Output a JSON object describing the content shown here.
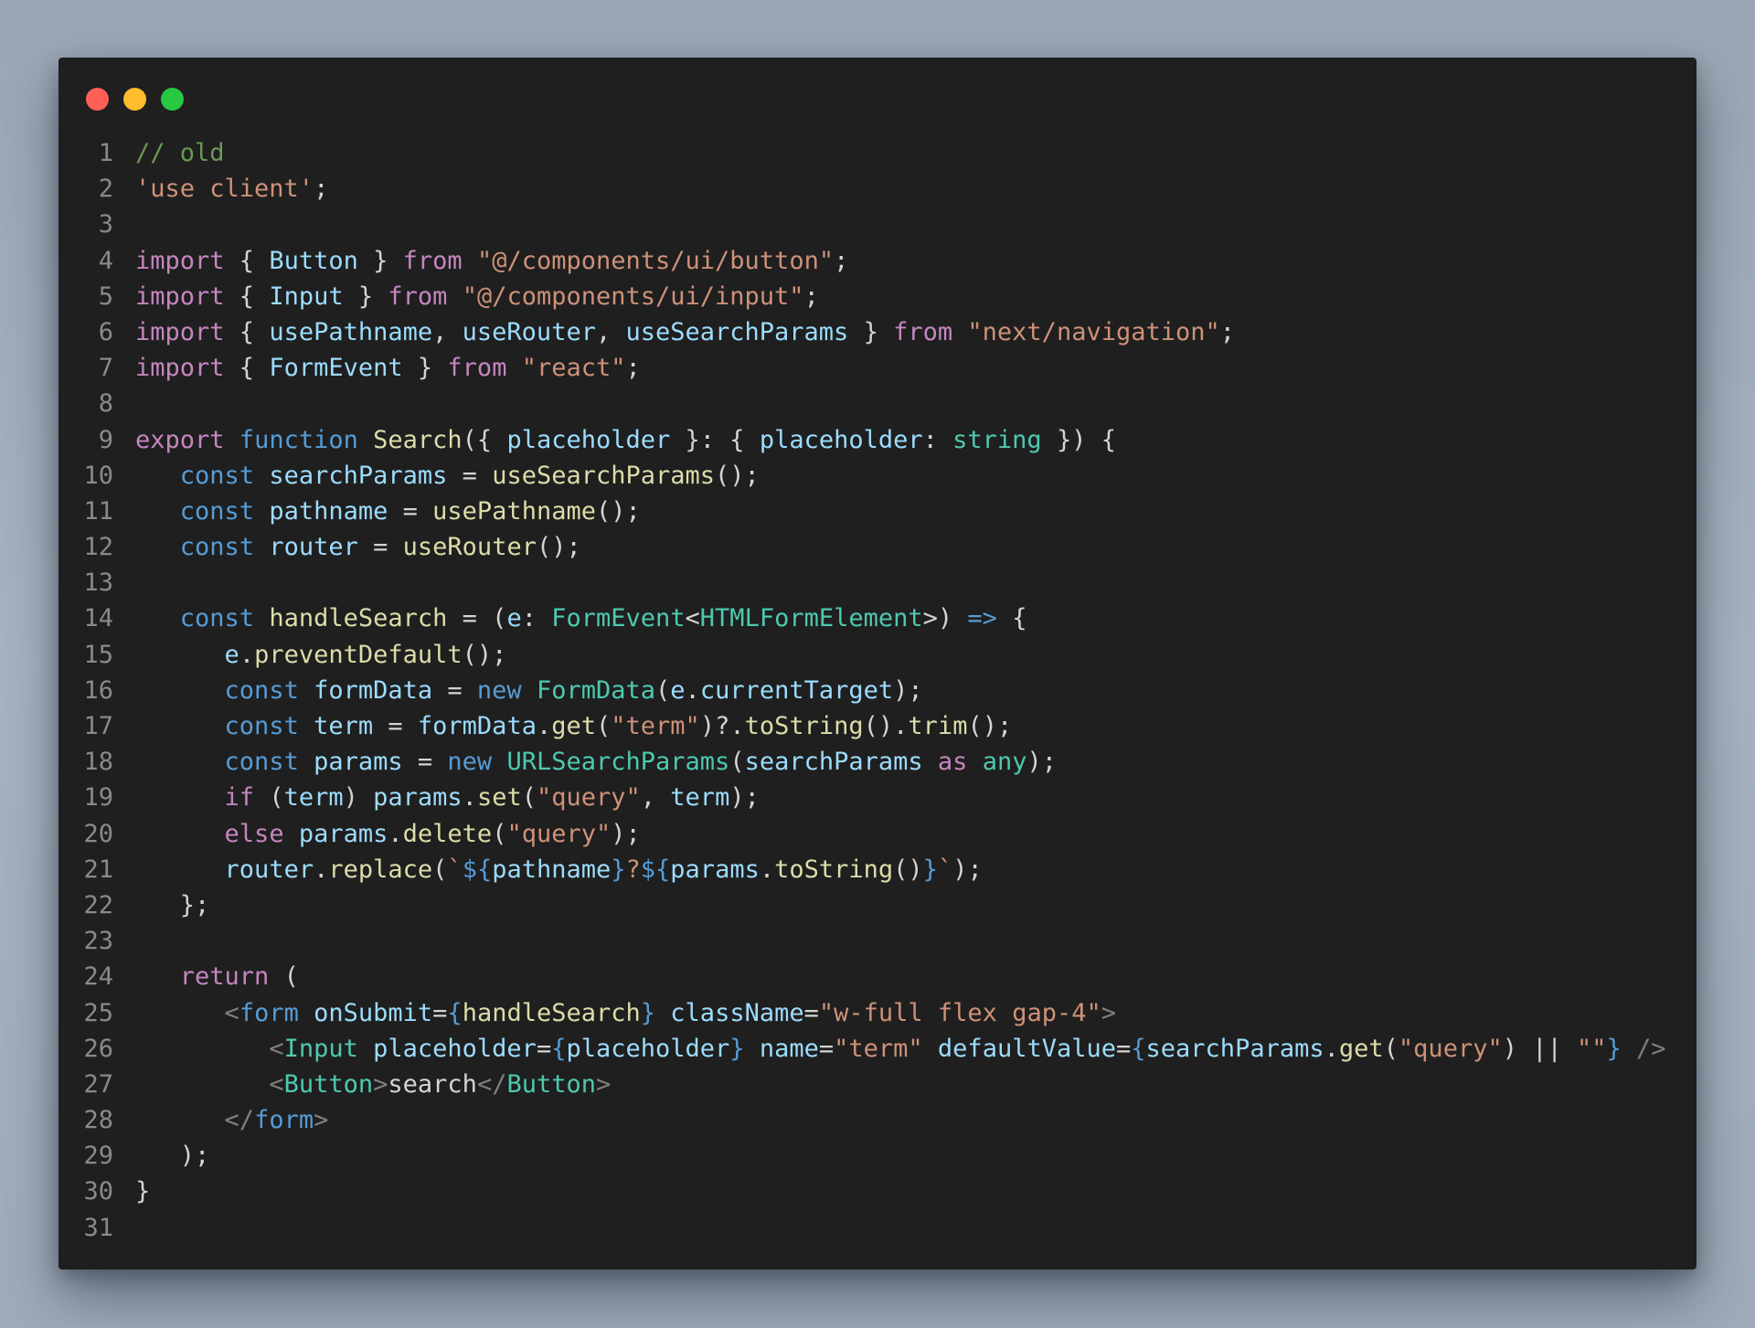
{
  "window": {
    "traffic_lights": {
      "close_color": "#ff5f57",
      "minimize_color": "#febc2e",
      "zoom_color": "#28c840"
    }
  },
  "colors": {
    "background": "#a4b0bd",
    "editor_background": "#1f1f1f",
    "line_number": "#8a8a8a",
    "comment": "#6a9955",
    "keyword": "#c586c0",
    "declaration": "#569cd6",
    "string": "#ce9178",
    "variable": "#9cdcfe",
    "function": "#dcdcaa",
    "type": "#4ec9b0",
    "plain": "#d4d4d4",
    "tag_bracket": "#808080"
  },
  "code": {
    "lines": [
      {
        "n": "1",
        "tokens": [
          [
            "comment",
            "// old"
          ]
        ]
      },
      {
        "n": "2",
        "tokens": [
          [
            "str",
            "'use client'"
          ],
          [
            "punct",
            ";"
          ]
        ]
      },
      {
        "n": "3",
        "tokens": []
      },
      {
        "n": "4",
        "tokens": [
          [
            "kw",
            "import"
          ],
          [
            "punct",
            " { "
          ],
          [
            "var",
            "Button"
          ],
          [
            "punct",
            " } "
          ],
          [
            "kw",
            "from"
          ],
          [
            "punct",
            " "
          ],
          [
            "str",
            "\"@/components/ui/button\""
          ],
          [
            "punct",
            ";"
          ]
        ]
      },
      {
        "n": "5",
        "tokens": [
          [
            "kw",
            "import"
          ],
          [
            "punct",
            " { "
          ],
          [
            "var",
            "Input"
          ],
          [
            "punct",
            " } "
          ],
          [
            "kw",
            "from"
          ],
          [
            "punct",
            " "
          ],
          [
            "str",
            "\"@/components/ui/input\""
          ],
          [
            "punct",
            ";"
          ]
        ]
      },
      {
        "n": "6",
        "tokens": [
          [
            "kw",
            "import"
          ],
          [
            "punct",
            " { "
          ],
          [
            "var",
            "usePathname"
          ],
          [
            "punct",
            ", "
          ],
          [
            "var",
            "useRouter"
          ],
          [
            "punct",
            ", "
          ],
          [
            "var",
            "useSearchParams"
          ],
          [
            "punct",
            " } "
          ],
          [
            "kw",
            "from"
          ],
          [
            "punct",
            " "
          ],
          [
            "str",
            "\"next/navigation\""
          ],
          [
            "punct",
            ";"
          ]
        ]
      },
      {
        "n": "7",
        "tokens": [
          [
            "kw",
            "import"
          ],
          [
            "punct",
            " { "
          ],
          [
            "var",
            "FormEvent"
          ],
          [
            "punct",
            " } "
          ],
          [
            "kw",
            "from"
          ],
          [
            "punct",
            " "
          ],
          [
            "str",
            "\"react\""
          ],
          [
            "punct",
            ";"
          ]
        ]
      },
      {
        "n": "8",
        "tokens": []
      },
      {
        "n": "9",
        "tokens": [
          [
            "kw",
            "export"
          ],
          [
            "punct",
            " "
          ],
          [
            "decl",
            "function"
          ],
          [
            "punct",
            " "
          ],
          [
            "fn",
            "Search"
          ],
          [
            "punct",
            "({ "
          ],
          [
            "var",
            "placeholder"
          ],
          [
            "punct",
            " }: { "
          ],
          [
            "var",
            "placeholder"
          ],
          [
            "punct",
            ": "
          ],
          [
            "type",
            "string"
          ],
          [
            "punct",
            " }) {"
          ]
        ]
      },
      {
        "n": "10",
        "tokens": [
          [
            "punct",
            "   "
          ],
          [
            "decl",
            "const"
          ],
          [
            "punct",
            " "
          ],
          [
            "var",
            "searchParams"
          ],
          [
            "punct",
            " = "
          ],
          [
            "fn",
            "useSearchParams"
          ],
          [
            "punct",
            "();"
          ]
        ]
      },
      {
        "n": "11",
        "tokens": [
          [
            "punct",
            "   "
          ],
          [
            "decl",
            "const"
          ],
          [
            "punct",
            " "
          ],
          [
            "var",
            "pathname"
          ],
          [
            "punct",
            " = "
          ],
          [
            "fn",
            "usePathname"
          ],
          [
            "punct",
            "();"
          ]
        ]
      },
      {
        "n": "12",
        "tokens": [
          [
            "punct",
            "   "
          ],
          [
            "decl",
            "const"
          ],
          [
            "punct",
            " "
          ],
          [
            "var",
            "router"
          ],
          [
            "punct",
            " = "
          ],
          [
            "fn",
            "useRouter"
          ],
          [
            "punct",
            "();"
          ]
        ]
      },
      {
        "n": "13",
        "tokens": []
      },
      {
        "n": "14",
        "tokens": [
          [
            "punct",
            "   "
          ],
          [
            "decl",
            "const"
          ],
          [
            "punct",
            " "
          ],
          [
            "fn",
            "handleSearch"
          ],
          [
            "punct",
            " = ("
          ],
          [
            "var",
            "e"
          ],
          [
            "punct",
            ": "
          ],
          [
            "type",
            "FormEvent"
          ],
          [
            "punct",
            "<"
          ],
          [
            "type",
            "HTMLFormElement"
          ],
          [
            "punct",
            ">) "
          ],
          [
            "decl",
            "=>"
          ],
          [
            "punct",
            " {"
          ]
        ]
      },
      {
        "n": "15",
        "tokens": [
          [
            "punct",
            "      "
          ],
          [
            "var",
            "e"
          ],
          [
            "punct",
            "."
          ],
          [
            "fn",
            "preventDefault"
          ],
          [
            "punct",
            "();"
          ]
        ]
      },
      {
        "n": "16",
        "tokens": [
          [
            "punct",
            "      "
          ],
          [
            "decl",
            "const"
          ],
          [
            "punct",
            " "
          ],
          [
            "var",
            "formData"
          ],
          [
            "punct",
            " = "
          ],
          [
            "decl",
            "new"
          ],
          [
            "punct",
            " "
          ],
          [
            "type",
            "FormData"
          ],
          [
            "punct",
            "("
          ],
          [
            "var",
            "e"
          ],
          [
            "punct",
            "."
          ],
          [
            "var",
            "currentTarget"
          ],
          [
            "punct",
            ");"
          ]
        ]
      },
      {
        "n": "17",
        "tokens": [
          [
            "punct",
            "      "
          ],
          [
            "decl",
            "const"
          ],
          [
            "punct",
            " "
          ],
          [
            "var",
            "term"
          ],
          [
            "punct",
            " = "
          ],
          [
            "var",
            "formData"
          ],
          [
            "punct",
            "."
          ],
          [
            "fn",
            "get"
          ],
          [
            "punct",
            "("
          ],
          [
            "str",
            "\"term\""
          ],
          [
            "punct",
            ")?."
          ],
          [
            "fn",
            "toString"
          ],
          [
            "punct",
            "()."
          ],
          [
            "fn",
            "trim"
          ],
          [
            "punct",
            "();"
          ]
        ]
      },
      {
        "n": "18",
        "tokens": [
          [
            "punct",
            "      "
          ],
          [
            "decl",
            "const"
          ],
          [
            "punct",
            " "
          ],
          [
            "var",
            "params"
          ],
          [
            "punct",
            " = "
          ],
          [
            "decl",
            "new"
          ],
          [
            "punct",
            " "
          ],
          [
            "type",
            "URLSearchParams"
          ],
          [
            "punct",
            "("
          ],
          [
            "var",
            "searchParams"
          ],
          [
            "punct",
            " "
          ],
          [
            "kw",
            "as"
          ],
          [
            "punct",
            " "
          ],
          [
            "type",
            "any"
          ],
          [
            "punct",
            ");"
          ]
        ]
      },
      {
        "n": "19",
        "tokens": [
          [
            "punct",
            "      "
          ],
          [
            "kw",
            "if"
          ],
          [
            "punct",
            " ("
          ],
          [
            "var",
            "term"
          ],
          [
            "punct",
            ") "
          ],
          [
            "var",
            "params"
          ],
          [
            "punct",
            "."
          ],
          [
            "fn",
            "set"
          ],
          [
            "punct",
            "("
          ],
          [
            "str",
            "\"query\""
          ],
          [
            "punct",
            ", "
          ],
          [
            "var",
            "term"
          ],
          [
            "punct",
            ");"
          ]
        ]
      },
      {
        "n": "20",
        "tokens": [
          [
            "punct",
            "      "
          ],
          [
            "kw",
            "else"
          ],
          [
            "punct",
            " "
          ],
          [
            "var",
            "params"
          ],
          [
            "punct",
            "."
          ],
          [
            "fn",
            "delete"
          ],
          [
            "punct",
            "("
          ],
          [
            "str",
            "\"query\""
          ],
          [
            "punct",
            ");"
          ]
        ]
      },
      {
        "n": "21",
        "tokens": [
          [
            "punct",
            "      "
          ],
          [
            "var",
            "router"
          ],
          [
            "punct",
            "."
          ],
          [
            "fn",
            "replace"
          ],
          [
            "punct",
            "("
          ],
          [
            "str",
            "`"
          ],
          [
            "decl",
            "${"
          ],
          [
            "var",
            "pathname"
          ],
          [
            "decl",
            "}"
          ],
          [
            "str",
            "?"
          ],
          [
            "decl",
            "${"
          ],
          [
            "var",
            "params"
          ],
          [
            "punct",
            "."
          ],
          [
            "fn",
            "toString"
          ],
          [
            "punct",
            "()"
          ],
          [
            "decl",
            "}"
          ],
          [
            "str",
            "`"
          ],
          [
            "punct",
            ");"
          ]
        ]
      },
      {
        "n": "22",
        "tokens": [
          [
            "punct",
            "   };"
          ]
        ]
      },
      {
        "n": "23",
        "tokens": []
      },
      {
        "n": "24",
        "tokens": [
          [
            "punct",
            "   "
          ],
          [
            "kw",
            "return"
          ],
          [
            "punct",
            " ("
          ]
        ]
      },
      {
        "n": "25",
        "tokens": [
          [
            "punct",
            "      "
          ],
          [
            "tag",
            "<"
          ],
          [
            "decl",
            "form"
          ],
          [
            "punct",
            " "
          ],
          [
            "var",
            "onSubmit"
          ],
          [
            "punct",
            "="
          ],
          [
            "decl",
            "{"
          ],
          [
            "fn",
            "handleSearch"
          ],
          [
            "decl",
            "}"
          ],
          [
            "punct",
            " "
          ],
          [
            "var",
            "className"
          ],
          [
            "punct",
            "="
          ],
          [
            "str",
            "\"w-full flex gap-4\""
          ],
          [
            "tag",
            ">"
          ]
        ]
      },
      {
        "n": "26",
        "tokens": [
          [
            "punct",
            "         "
          ],
          [
            "tag",
            "<"
          ],
          [
            "type",
            "Input"
          ],
          [
            "punct",
            " "
          ],
          [
            "var",
            "placeholder"
          ],
          [
            "punct",
            "="
          ],
          [
            "decl",
            "{"
          ],
          [
            "var",
            "placeholder"
          ],
          [
            "decl",
            "}"
          ],
          [
            "punct",
            " "
          ],
          [
            "var",
            "name"
          ],
          [
            "punct",
            "="
          ],
          [
            "str",
            "\"term\""
          ],
          [
            "punct",
            " "
          ],
          [
            "var",
            "defaultValue"
          ],
          [
            "punct",
            "="
          ],
          [
            "decl",
            "{"
          ],
          [
            "var",
            "searchParams"
          ],
          [
            "punct",
            "."
          ],
          [
            "fn",
            "get"
          ],
          [
            "punct",
            "("
          ],
          [
            "str",
            "\"query\""
          ],
          [
            "punct",
            ") || "
          ],
          [
            "str",
            "\"\""
          ],
          [
            "decl",
            "}"
          ],
          [
            "punct",
            " "
          ],
          [
            "tag",
            "/>"
          ]
        ]
      },
      {
        "n": "27",
        "tokens": [
          [
            "punct",
            "         "
          ],
          [
            "tag",
            "<"
          ],
          [
            "type",
            "Button"
          ],
          [
            "tag",
            ">"
          ],
          [
            "punct",
            "search"
          ],
          [
            "tag",
            "</"
          ],
          [
            "type",
            "Button"
          ],
          [
            "tag",
            ">"
          ]
        ]
      },
      {
        "n": "28",
        "tokens": [
          [
            "punct",
            "      "
          ],
          [
            "tag",
            "</"
          ],
          [
            "decl",
            "form"
          ],
          [
            "tag",
            ">"
          ]
        ]
      },
      {
        "n": "29",
        "tokens": [
          [
            "punct",
            "   );"
          ]
        ]
      },
      {
        "n": "30",
        "tokens": [
          [
            "punct",
            "}"
          ]
        ]
      },
      {
        "n": "31",
        "tokens": []
      }
    ]
  }
}
